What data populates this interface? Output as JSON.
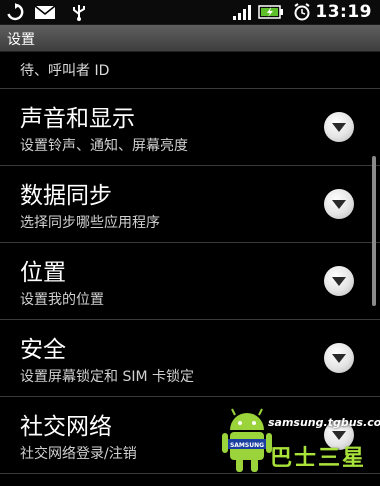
{
  "status_bar": {
    "time": "13:19",
    "icons": [
      "sync-icon",
      "mail-icon",
      "usb-icon",
      "signal-icon",
      "battery-charging-icon",
      "alarm-icon"
    ]
  },
  "title_bar": {
    "title": "设置"
  },
  "partial_item": {
    "summary": "待、呼叫者 ID"
  },
  "items": [
    {
      "title": "声音和显示",
      "summary": "设置铃声、通知、屏幕亮度"
    },
    {
      "title": "数据同步",
      "summary": "选择同步哪些应用程序"
    },
    {
      "title": "位置",
      "summary": "设置我的位置"
    },
    {
      "title": "安全",
      "summary": "设置屏幕锁定和 SIM 卡锁定"
    },
    {
      "title": "社交网络",
      "summary": "社交网络登录/注销"
    }
  ],
  "watermark": {
    "url": "samsung.tgbus.com",
    "badge": "SAMSUNG",
    "cn": "巴士三星"
  },
  "colors": {
    "accent_green": "#a8e23a",
    "title_bar": "#4a4a4a",
    "background": "#000000"
  }
}
